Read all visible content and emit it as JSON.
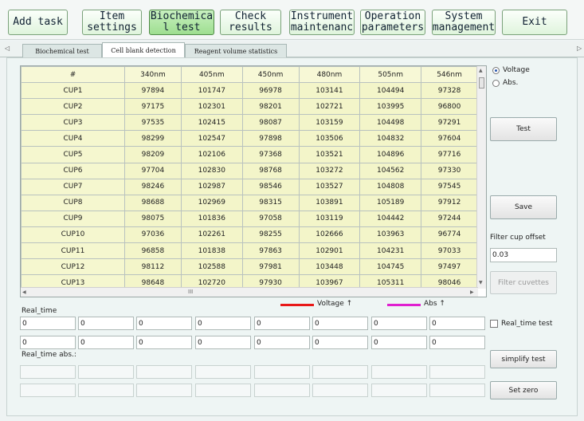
{
  "toolbar": {
    "buttons": [
      {
        "label": "Add task",
        "underline": ""
      },
      {
        "label": "Item\nsettings",
        "underline": ""
      },
      {
        "label": "Biochemica\nl test",
        "underline": ""
      },
      {
        "label": "Check\nresults",
        "underline": ""
      },
      {
        "label": "Instrument\nmaintenanc",
        "underline": ""
      },
      {
        "label": "Operation\nparameters",
        "underline": ""
      },
      {
        "label": "System\nmanagement",
        "underline": ""
      },
      {
        "label": "Exit",
        "underline": ""
      }
    ],
    "active_index": 2
  },
  "tabs": [
    "Biochemical test",
    "Cell blank detection",
    "Reagent volume statistics"
  ],
  "active_tab": 1,
  "table": {
    "columns": [
      "#",
      "340nm",
      "405nm",
      "450nm",
      "480nm",
      "505nm",
      "546nm"
    ],
    "rows": [
      [
        "CUP1",
        "97894",
        "101747",
        "96978",
        "103141",
        "104494",
        "97328"
      ],
      [
        "CUP2",
        "97175",
        "102301",
        "98201",
        "102721",
        "103995",
        "96800"
      ],
      [
        "CUP3",
        "97535",
        "102415",
        "98087",
        "103159",
        "104498",
        "97291"
      ],
      [
        "CUP4",
        "98299",
        "102547",
        "97898",
        "103506",
        "104832",
        "97604"
      ],
      [
        "CUP5",
        "98209",
        "102106",
        "97368",
        "103521",
        "104896",
        "97716"
      ],
      [
        "CUP6",
        "97704",
        "102830",
        "98768",
        "103272",
        "104562",
        "97330"
      ],
      [
        "CUP7",
        "98246",
        "102987",
        "98546",
        "103527",
        "104808",
        "97545"
      ],
      [
        "CUP8",
        "98688",
        "102969",
        "98315",
        "103891",
        "105189",
        "97912"
      ],
      [
        "CUP9",
        "98075",
        "101836",
        "97058",
        "103119",
        "104442",
        "97244"
      ],
      [
        "CUP10",
        "97036",
        "102261",
        "98255",
        "102666",
        "103963",
        "96774"
      ],
      [
        "CUP11",
        "96858",
        "101838",
        "97863",
        "102901",
        "104231",
        "97033"
      ],
      [
        "CUP12",
        "98112",
        "102588",
        "97981",
        "103448",
        "104745",
        "97497"
      ],
      [
        "CUP13",
        "98648",
        "102720",
        "97930",
        "103967",
        "105311",
        "98046"
      ]
    ],
    "hscroll_grip": "III"
  },
  "mode": {
    "voltage_label": "Voltage",
    "abs_label": "Abs.",
    "selected": "voltage"
  },
  "buttons": {
    "test": "Test",
    "save": "Save",
    "filter_cuvettes": "Filter cuvettes",
    "simplify_test": "simplify test",
    "set_zero": "Set zero"
  },
  "filter_cup_offset": {
    "label": "Filter cup offset",
    "value": "0.03"
  },
  "legend": {
    "voltage_label": "Voltage ↑",
    "abs_label": "Abs ↑",
    "voltage_color": "#e81818",
    "abs_color": "#e020d0"
  },
  "realtime": {
    "label": "Real_time",
    "row1": [
      "0",
      "0",
      "0",
      "0",
      "0",
      "0",
      "0",
      "0"
    ],
    "row2": [
      "0",
      "0",
      "0",
      "0",
      "0",
      "0",
      "0",
      "0"
    ],
    "abs_label": "Real_time abs.:",
    "checkbox_label": "Real_time test",
    "checkbox_checked": false
  },
  "icons": {
    "tab_scroll_left": "triangle-left-icon",
    "tab_scroll_right": "triangle-right-icon"
  }
}
